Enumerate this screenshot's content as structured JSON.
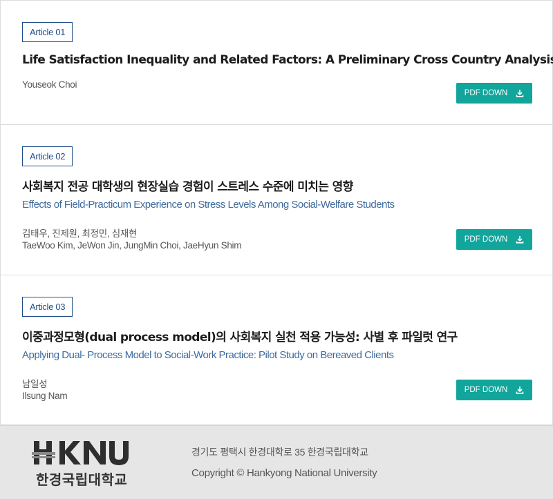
{
  "articles": [
    {
      "badge": "Article 01",
      "title": "Life Satisfaction Inequality and Related Factors: A Preliminary Cross Country Analysis",
      "author_en": "Youseok Choi",
      "pdf_label": "PDF DOWN"
    },
    {
      "badge": "Article 02",
      "title": "사회복지 전공 대학생의 현장실습 경험이 스트레스 수준에 미치는 영향",
      "subtitle": "Effects of Field-Practicum Experience on Stress Levels Among Social-Welfare Students",
      "author_ko": "김태우, 진제원, 최정민, 심재현",
      "author_en": "TaeWoo Kim, JeWon Jin, JungMin Choi, JaeHyun Shim",
      "pdf_label": "PDF DOWN"
    },
    {
      "badge": "Article 03",
      "title": "이중과정모형(dual process model)의 사회복지 실천 적용 가능성: 사별 후 파일럿 연구",
      "subtitle": "Applying Dual- Process Model to Social-Work Practice: Pilot Study on Bereaved Clients",
      "author_ko": "남일성",
      "author_en": "Ilsung Nam",
      "pdf_label": "PDF DOWN"
    }
  ],
  "footer": {
    "logo_text": "HKNU",
    "logo_ko": "한경국립대학교",
    "address": "경기도 평택시 한경대학로 35 한경국립대학교",
    "copyright": "Copyright © Hankyong National University"
  },
  "colors": {
    "accent": "#12a59b",
    "badge": "#1f4e89",
    "subtitle": "#3d6a9e"
  },
  "icons": {
    "download": "download-icon"
  }
}
